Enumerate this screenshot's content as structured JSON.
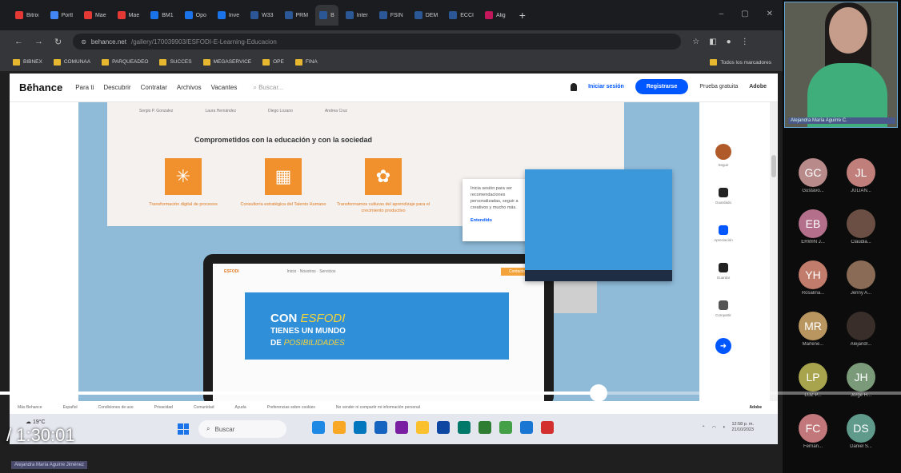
{
  "browser": {
    "tabs": [
      {
        "label": "Bitrix",
        "color": "#e53935"
      },
      {
        "label": "Portl",
        "color": "#4285f4"
      },
      {
        "label": "Mae",
        "color": "#e53935"
      },
      {
        "label": "Mae",
        "color": "#e53935"
      },
      {
        "label": "BM1",
        "color": "#1a73e8"
      },
      {
        "label": "Opo",
        "color": "#1a73e8"
      },
      {
        "label": "Inve",
        "color": "#1a73e8"
      },
      {
        "label": "W33",
        "color": "#2b5797"
      },
      {
        "label": "PRM",
        "color": "#2b5797"
      },
      {
        "label": "B",
        "color": "#2b5797",
        "active": true
      },
      {
        "label": "Inter",
        "color": "#2b5797"
      },
      {
        "label": "FSIN",
        "color": "#2b5797"
      },
      {
        "label": "DEM",
        "color": "#2b5797"
      },
      {
        "label": "ECCI",
        "color": "#2b5797"
      },
      {
        "label": "Alig",
        "color": "#c2185b"
      }
    ],
    "url_host": "behance.net",
    "url_path": "/gallery/170039903/ESFODI-E-Learning-Educacion",
    "bookmarks": [
      "BIBNEX",
      "COMUNAA",
      "PARQUEADEO",
      "SUCCES",
      "MEGASERVICE",
      "OPE",
      "FINA"
    ],
    "bookmarks_right": "Todos los marcadores"
  },
  "behance": {
    "logo": "Bēhance",
    "nav": [
      "Para ti",
      "Descubrir",
      "Contratar",
      "Archivos",
      "Vacantes"
    ],
    "search_placeholder": "Buscar...",
    "login": "Iniciar sesión",
    "register": "Registrarse",
    "trial": "Prueba gratuita",
    "adobe": "Adobe",
    "team": [
      "Sergio P. Gonzalez",
      "Laura Hernández",
      "Diego Lozano",
      "Andrea Cruz"
    ],
    "section_title": "Comprometidos con la educación y con la sociedad",
    "features": [
      {
        "icon": "✳",
        "caption": "Transformación digital de procesos"
      },
      {
        "icon": "▦",
        "caption": "Consultoría estratégica del Talento Humano"
      },
      {
        "icon": "✿",
        "caption": "Transformamos culturas del aprendizaje para el crecimiento productivo"
      }
    ],
    "popup_text": "Inicia sesión para ver recomendaciones personalizadas, seguir a creativos y mucho más.",
    "popup_link": "Entendido",
    "laptop_nav": [
      "ESFODI",
      "Inicio · Nosotros · Servicios",
      "Contacto"
    ],
    "banner_line1": "CON",
    "banner_accent": "ESFODI",
    "banner_line2": "TIENES UN MUNDO",
    "banner_line3": "DE",
    "banner_accent2": "POSIBILIDADES",
    "side_labels": [
      "Seguir",
      "Guardado",
      "Apreciación",
      "Guardar",
      "Compartir",
      "Subir"
    ],
    "footer": [
      "Más Behance",
      "Español",
      "Condiciones de uso",
      "Privacidad",
      "Comunidad",
      "Ayuda",
      "Preferencias sobre cookies",
      "No vender ni compartir mi información personal"
    ]
  },
  "taskbar": {
    "weather": "19°C",
    "search": "Buscar",
    "time": "12:58 p. m.",
    "date": "21/10/2023",
    "app_colors": [
      "#1e88e5",
      "#f9a825",
      "#0277bd",
      "#1565c0",
      "#7b1fa2",
      "#fbc02d",
      "#0d47a1",
      "#00796b",
      "#2e7d32",
      "#43a047",
      "#1976d2",
      "#d32f2f"
    ]
  },
  "video": {
    "time_display": "/ 1:30:01",
    "progress_fraction": 0.664,
    "presenter": "Alejandra María Aguirre Jiménez"
  },
  "meeting": {
    "camera_name": "Alejandra María Aguirre C.",
    "participants": [
      {
        "initials": "GC",
        "name": "Gustavo...",
        "color": "#b88a8a"
      },
      {
        "initials": "JL",
        "name": "JULIÁN...",
        "color": "#c07f7a"
      },
      {
        "initials": "EB",
        "name": "ERWIN J...",
        "color": "#b4708a"
      },
      {
        "initials": "",
        "name": "Claudia...",
        "color": "#6b4f45"
      },
      {
        "initials": "YH",
        "name": "Rosalina...",
        "color": "#c27c6c"
      },
      {
        "initials": "",
        "name": "Jenny A...",
        "color": "#8a6b55"
      },
      {
        "initials": "MR",
        "name": "Marlene...",
        "color": "#b9965f"
      },
      {
        "initials": "",
        "name": "Alejandr...",
        "color": "#3a2e2a"
      },
      {
        "initials": "LP",
        "name": "LUZ P...",
        "color": "#a8a44e"
      },
      {
        "initials": "JH",
        "name": "Jorge H...",
        "color": "#7a9a7a"
      },
      {
        "initials": "FC",
        "name": "Fernan...",
        "color": "#c2787a"
      },
      {
        "initials": "DS",
        "name": "Daniel S...",
        "color": "#5f9a8a"
      }
    ]
  }
}
